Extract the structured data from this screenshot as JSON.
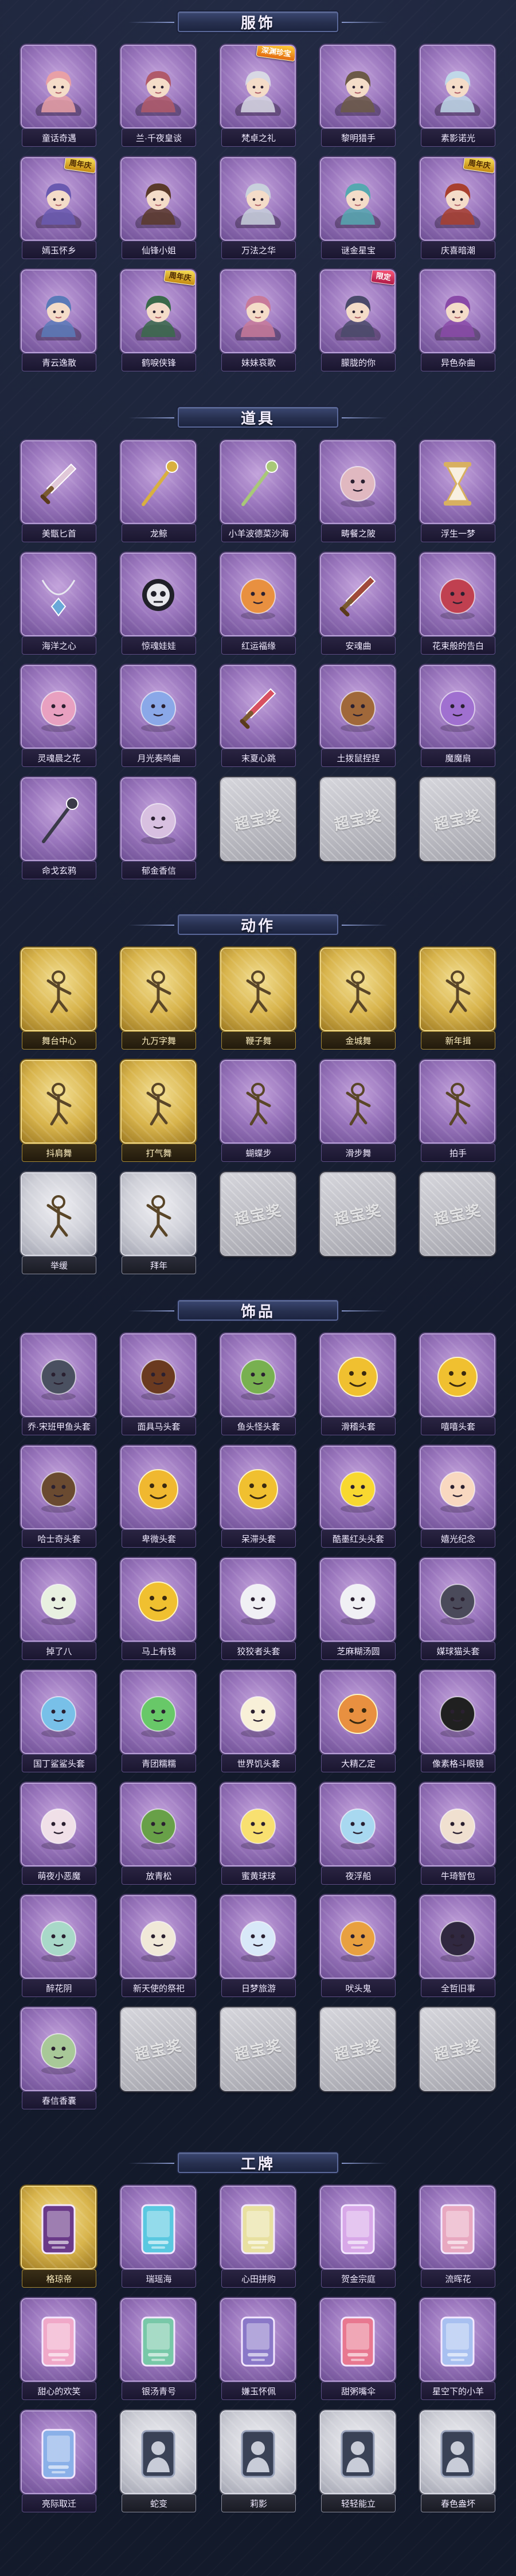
{
  "sections": [
    {
      "title": "服饰",
      "items": [
        {
          "label": "童话奇遇",
          "tier": "purple",
          "icon": "character-portrait-icon",
          "hue": "#e8a0a6"
        },
        {
          "label": "兰·千夜皇谈",
          "tier": "purple",
          "icon": "character-portrait-icon",
          "hue": "#b05a6a"
        },
        {
          "label": "梵卓之礼",
          "tier": "purple",
          "icon": "character-portrait-icon",
          "hue": "#d8d8e4",
          "tag": "深渊珍宝"
        },
        {
          "label": "黎明猎手",
          "tier": "purple",
          "icon": "character-portrait-icon",
          "hue": "#6c5a48"
        },
        {
          "label": "素影诺光",
          "tier": "purple",
          "icon": "character-portrait-icon",
          "hue": "#c0d8e8"
        },
        {
          "label": "嫣玉怀乡",
          "tier": "purple",
          "icon": "character-portrait-icon",
          "hue": "#6a5ab0",
          "tag": "周年庆"
        },
        {
          "label": "仙锋小姐",
          "tier": "purple",
          "icon": "character-portrait-icon",
          "hue": "#5a3a2a"
        },
        {
          "label": "万法之华",
          "tier": "purple",
          "icon": "character-portrait-icon",
          "hue": "#c8d0dc"
        },
        {
          "label": "谜金星宝",
          "tier": "purple",
          "icon": "character-portrait-icon",
          "hue": "#56a8b0"
        },
        {
          "label": "庆喜暗潮",
          "tier": "purple",
          "icon": "character-portrait-icon",
          "hue": "#a8402e",
          "tag": "周年庆"
        },
        {
          "label": "青云逸散",
          "tier": "purple",
          "icon": "character-portrait-icon",
          "hue": "#5a7ab8"
        },
        {
          "label": "鹤唳侠锋",
          "tier": "purple",
          "icon": "character-portrait-icon",
          "hue": "#3a6a4a",
          "tag": "周年庆"
        },
        {
          "label": "妹妹哀歌",
          "tier": "purple",
          "icon": "character-portrait-icon",
          "hue": "#c87a9a"
        },
        {
          "label": "朦胧的你",
          "tier": "purple",
          "icon": "character-portrait-icon",
          "hue": "#4a4a6a",
          "tag": "限定"
        },
        {
          "label": "异色杂曲",
          "tier": "purple",
          "icon": "character-portrait-icon",
          "hue": "#8a4aa8"
        }
      ]
    },
    {
      "title": "道具",
      "items": [
        {
          "label": "美甑匕首",
          "tier": "purple",
          "icon": "dagger-icon",
          "hue": "#e0c8d8"
        },
        {
          "label": "龙鲸",
          "tier": "purple",
          "icon": "golden-staff-icon",
          "hue": "#d8b040"
        },
        {
          "label": "小羊波德菜沙海",
          "tier": "purple",
          "icon": "staff-icon",
          "hue": "#a8c878"
        },
        {
          "label": "畴餐之陂",
          "tier": "purple",
          "icon": "bow-icon",
          "hue": "#e0b8c0"
        },
        {
          "label": "浮生一梦",
          "tier": "purple",
          "icon": "hourglass-icon",
          "hue": "#d8b060"
        },
        {
          "label": "海洋之心",
          "tier": "purple",
          "icon": "necklace-icon",
          "hue": "#6aa8d8"
        },
        {
          "label": "惊魂娃娃",
          "tier": "purple",
          "icon": "skull-doll-icon",
          "hue": "#e8e8ec"
        },
        {
          "label": "红运福缘",
          "tier": "purple",
          "icon": "lucky-pot-icon",
          "hue": "#e89040"
        },
        {
          "label": "安魂曲",
          "tier": "purple",
          "icon": "knife-icon",
          "hue": "#a04a3a"
        },
        {
          "label": "花束般的告白",
          "tier": "purple",
          "icon": "rose-icon",
          "hue": "#c04050"
        },
        {
          "label": "灵魂晨之花",
          "tier": "purple",
          "icon": "flower-basket-icon",
          "hue": "#e8a0c0"
        },
        {
          "label": "月光奏鸣曲",
          "tier": "purple",
          "icon": "piano-icon",
          "hue": "#8aa8e8"
        },
        {
          "label": "末夏心跳",
          "tier": "purple",
          "icon": "sword-icon",
          "hue": "#d85060"
        },
        {
          "label": "土拨鼠捏捏",
          "tier": "purple",
          "icon": "groundhog-icon",
          "hue": "#a0683a"
        },
        {
          "label": "魔魔扇",
          "tier": "purple",
          "icon": "fan-icon",
          "hue": "#a070d0"
        },
        {
          "label": "命戈玄鸦",
          "tier": "purple",
          "icon": "crow-spear-icon",
          "hue": "#3a3a48"
        },
        {
          "label": "郁金香信",
          "tier": "purple",
          "icon": "tulip-icon",
          "hue": "#d8c0e0"
        },
        {
          "label": "",
          "tier": "placeholder",
          "icon": "placeholder-icon"
        },
        {
          "label": "",
          "tier": "placeholder",
          "icon": "placeholder-icon"
        },
        {
          "label": "",
          "tier": "placeholder",
          "icon": "placeholder-icon"
        }
      ]
    },
    {
      "title": "动作",
      "items": [
        {
          "label": "舞台中心",
          "tier": "gold",
          "icon": "pose-figure-icon"
        },
        {
          "label": "九万字舞",
          "tier": "gold",
          "icon": "pose-figure-icon"
        },
        {
          "label": "鞭子舞",
          "tier": "gold",
          "icon": "pose-figure-icon"
        },
        {
          "label": "金城舞",
          "tier": "gold",
          "icon": "pose-figure-icon"
        },
        {
          "label": "新年揖",
          "tier": "gold",
          "icon": "pose-figure-icon"
        },
        {
          "label": "抖肩舞",
          "tier": "gold",
          "icon": "pose-figure-icon"
        },
        {
          "label": "打气舞",
          "tier": "gold",
          "icon": "pose-figure-icon"
        },
        {
          "label": "蝴蝶步",
          "tier": "purple",
          "icon": "pose-figure-icon"
        },
        {
          "label": "滑步舞",
          "tier": "purple",
          "icon": "pose-figure-icon"
        },
        {
          "label": "拍手",
          "tier": "purple",
          "icon": "pose-figure-icon"
        },
        {
          "label": "举缓",
          "tier": "silver",
          "icon": "pose-figure-icon"
        },
        {
          "label": "拜年",
          "tier": "silver",
          "icon": "pose-figure-icon"
        },
        {
          "label": "",
          "tier": "placeholder",
          "icon": "placeholder-icon"
        },
        {
          "label": "",
          "tier": "placeholder",
          "icon": "placeholder-icon"
        },
        {
          "label": "",
          "tier": "placeholder",
          "icon": "placeholder-icon"
        }
      ]
    },
    {
      "title": "饰品",
      "items": [
        {
          "label": "乔·宋班甲鱼头套",
          "tier": "purple",
          "icon": "fish-head-icon",
          "hue": "#4a5060"
        },
        {
          "label": "面具马头套",
          "tier": "purple",
          "icon": "horse-head-icon",
          "hue": "#6a3a20"
        },
        {
          "label": "鱼头怪头套",
          "tier": "purple",
          "icon": "fish-monster-head-icon",
          "hue": "#78b050"
        },
        {
          "label": "滑稽头套",
          "tier": "purple",
          "icon": "grin-face-icon",
          "hue": "#f0c030"
        },
        {
          "label": "嘻嘻头套",
          "tier": "purple",
          "icon": "laugh-face-icon",
          "hue": "#f0c030"
        },
        {
          "label": "哈士奇头套",
          "tier": "purple",
          "icon": "husky-head-icon",
          "hue": "#6a4a30"
        },
        {
          "label": "卑微头套",
          "tier": "purple",
          "icon": "sad-face-icon",
          "hue": "#f0b830"
        },
        {
          "label": "呆滞头套",
          "tier": "purple",
          "icon": "blank-face-icon",
          "hue": "#f0c030"
        },
        {
          "label": "酷墨红头头套",
          "tier": "purple",
          "icon": "cool-pikachu-icon",
          "hue": "#f8d830"
        },
        {
          "label": "嬉光纪念",
          "tier": "purple",
          "icon": "baby-face-icon",
          "hue": "#f8d8c0"
        },
        {
          "label": "掉了八",
          "tier": "purple",
          "icon": "radish-icon",
          "hue": "#e8f0e0"
        },
        {
          "label": "马上有钱",
          "tier": "purple",
          "icon": "money-face-icon",
          "hue": "#f0c030"
        },
        {
          "label": "狡狡者头套",
          "tier": "purple",
          "icon": "cloud-sheep-icon",
          "hue": "#f0f0f4"
        },
        {
          "label": "芝麻糊汤圆",
          "tier": "purple",
          "icon": "tangyuan-icon",
          "hue": "#f0f0f4"
        },
        {
          "label": "媒球猫头套",
          "tier": "purple",
          "icon": "cat-head-icon",
          "hue": "#4a4a5a"
        },
        {
          "label": "国丁鲨鲨头套",
          "tier": "purple",
          "icon": "shark-head-icon",
          "hue": "#78c0e8"
        },
        {
          "label": "青团糯糯",
          "tier": "purple",
          "icon": "qingtuan-icon",
          "hue": "#68c868"
        },
        {
          "label": "世界饥头套",
          "tier": "purple",
          "icon": "egg-head-icon",
          "hue": "#f8f0d8"
        },
        {
          "label": "大精乙定",
          "tier": "purple",
          "icon": "mooncake-icon",
          "hue": "#e89040"
        },
        {
          "label": "像素格斗眼镜",
          "tier": "purple",
          "icon": "pixel-glasses-icon",
          "hue": "#202020"
        },
        {
          "label": "萌夜小恶魔",
          "tier": "purple",
          "icon": "devil-mask-icon",
          "hue": "#f0e0e8"
        },
        {
          "label": "放青松",
          "tier": "purple",
          "icon": "bonsai-icon",
          "hue": "#68a048"
        },
        {
          "label": "蜜黄球球",
          "tier": "purple",
          "icon": "chick-icon",
          "hue": "#f8e070"
        },
        {
          "label": "夜浮船",
          "tier": "purple",
          "icon": "crystal-ship-icon",
          "hue": "#a8d8f0"
        },
        {
          "label": "牛琦智包",
          "tier": "purple",
          "icon": "cow-bun-icon",
          "hue": "#f0e0d0"
        },
        {
          "label": "醉花阴",
          "tier": "purple",
          "icon": "flower-veil-icon",
          "hue": "#a8d8c8"
        },
        {
          "label": "新天使的祭祀",
          "tier": "purple",
          "icon": "angel-doll-icon",
          "hue": "#f0e8d8"
        },
        {
          "label": "日梦旅游",
          "tier": "purple",
          "icon": "ghost-wisp-icon",
          "hue": "#d8e8f8"
        },
        {
          "label": "吠头鬼",
          "tier": "purple",
          "icon": "flower-head-icon",
          "hue": "#e8a040"
        },
        {
          "label": "全哲旧事",
          "tier": "purple",
          "icon": "chibi-doll-icon",
          "hue": "#302840"
        },
        {
          "label": "春信香囊",
          "tier": "purple",
          "icon": "sachet-icon",
          "hue": "#a8c898"
        },
        {
          "label": "",
          "tier": "placeholder",
          "icon": "placeholder-icon"
        },
        {
          "label": "",
          "tier": "placeholder",
          "icon": "placeholder-icon"
        },
        {
          "label": "",
          "tier": "placeholder",
          "icon": "placeholder-icon"
        },
        {
          "label": "",
          "tier": "placeholder",
          "icon": "placeholder-icon"
        }
      ]
    },
    {
      "title": "工牌",
      "items": [
        {
          "label": "格琼帝",
          "tier": "gold",
          "icon": "badge-card-icon",
          "hue": "#6a3a88"
        },
        {
          "label": "瑞瑶海",
          "tier": "purple",
          "icon": "badge-card-icon",
          "hue": "#5ac8e0"
        },
        {
          "label": "心田拼购",
          "tier": "purple",
          "icon": "badge-card-icon",
          "hue": "#e8e0a0"
        },
        {
          "label": "贺金宗庭",
          "tier": "purple",
          "icon": "badge-card-icon",
          "hue": "#d8a8e8"
        },
        {
          "label": "流晖花",
          "tier": "purple",
          "icon": "badge-card-icon",
          "hue": "#e8a8c0"
        },
        {
          "label": "甜心的欢笑",
          "tier": "purple",
          "icon": "badge-card-icon",
          "hue": "#f0a8c8"
        },
        {
          "label": "银汤青号",
          "tier": "purple",
          "icon": "badge-card-icon",
          "hue": "#78c8a8"
        },
        {
          "label": "嫌玉怀佩",
          "tier": "purple",
          "icon": "badge-card-icon",
          "hue": "#8a78c8"
        },
        {
          "label": "甜粥嘴伞",
          "tier": "purple",
          "icon": "badge-card-icon",
          "hue": "#e87890"
        },
        {
          "label": "星空下的小羊",
          "tier": "purple",
          "icon": "badge-card-icon",
          "hue": "#a8c0f0"
        },
        {
          "label": "亮际取迁",
          "tier": "purple",
          "icon": "badge-card-icon",
          "hue": "#8ab0e8"
        },
        {
          "label": "蛇变",
          "tier": "silver-dark",
          "icon": "silhouette-badge-icon"
        },
        {
          "label": "莉影",
          "tier": "silver-dark",
          "icon": "silhouette-badge-icon"
        },
        {
          "label": "轻轻能立",
          "tier": "silver-dark",
          "icon": "silhouette-badge-icon"
        },
        {
          "label": "春色盎坏",
          "tier": "silver-dark",
          "icon": "silhouette-badge-icon"
        }
      ]
    }
  ],
  "placeholder_text": "超宝奖"
}
